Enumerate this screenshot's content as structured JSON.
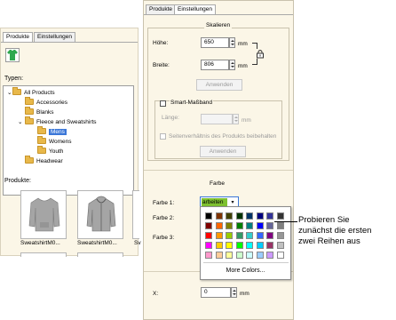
{
  "back_panel": {
    "tabs": [
      {
        "label": "Produkte"
      },
      {
        "label": "Einstellungen"
      }
    ],
    "types_label": "Typen:",
    "tree": [
      {
        "label": "All Products"
      },
      {
        "label": "Accessories"
      },
      {
        "label": "Blanks"
      },
      {
        "label": "Fleece and Sweatshirts"
      },
      {
        "label": "Mens"
      },
      {
        "label": "Womens"
      },
      {
        "label": "Youth"
      },
      {
        "label": "Headwear"
      }
    ],
    "products_label": "Produkte:",
    "products": [
      {
        "label": "SweatshirtM0..."
      },
      {
        "label": "SweatshirtM0..."
      },
      {
        "label": "Sv"
      }
    ]
  },
  "front_panel": {
    "tabs": [
      {
        "label": "Produkte"
      },
      {
        "label": "Einstellungen"
      }
    ],
    "scale": {
      "title": "Skalieren",
      "height_label": "Höhe:",
      "height_value": "650",
      "width_label": "Breite:",
      "width_value": "806",
      "unit": "mm",
      "apply_label": "Anwenden"
    },
    "smart": {
      "checkbox_label": "Smart-Maßband",
      "length_label": "Länge:",
      "length_unit": "mm",
      "keep_ratio_label": "Seitenverhältnis des Produkts beibehalten",
      "apply_label": "Anwenden"
    },
    "color": {
      "title": "Farbe",
      "color1_label": "Farbe 1:",
      "color1_value": "arbeiten",
      "color2_label": "Farbe 2:",
      "color3_label": "Farbe 3:",
      "more_colors_label": "More Colors..."
    },
    "x_label": "X:",
    "x_value": "0",
    "x_unit": "mm"
  },
  "palette": [
    [
      "#000000",
      "#7f3300",
      "#404000",
      "#003300",
      "#003366",
      "#000080",
      "#333399",
      "#333333"
    ],
    [
      "#800000",
      "#ff6600",
      "#808000",
      "#008000",
      "#008080",
      "#0000ff",
      "#666699",
      "#808080"
    ],
    [
      "#ff0000",
      "#ff9900",
      "#99cc00",
      "#339966",
      "#33cccc",
      "#3366ff",
      "#800080",
      "#969696"
    ],
    [
      "#ff00ff",
      "#ffcc00",
      "#ffff00",
      "#00ff00",
      "#00ffff",
      "#00ccff",
      "#993366",
      "#c0c0c0"
    ],
    [
      "#ff99cc",
      "#ffcc99",
      "#ffff99",
      "#ccffcc",
      "#ccffff",
      "#99ccff",
      "#cc99ff",
      "#ffffff"
    ]
  ],
  "callout": {
    "line1": "Probieren Sie",
    "line2": "zunächst die ersten",
    "line3": "zwei Reihen aus"
  },
  "colors": {
    "panel_bg": "#fbf6e7",
    "selection": "#3b77d8",
    "color1_swatch": "#7ec130",
    "tshirt": "#2fa84f"
  }
}
